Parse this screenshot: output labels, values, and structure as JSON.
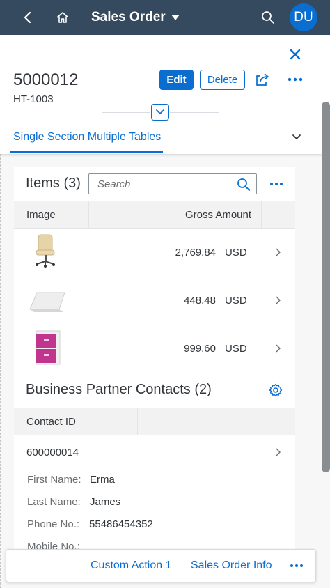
{
  "shell": {
    "title": "Sales Order",
    "avatar_initials": "DU",
    "icons": [
      "back-icon",
      "home-icon",
      "caret-down-icon",
      "search-icon"
    ],
    "background": "#354a5f"
  },
  "header": {
    "object_title": "5000012",
    "object_subtitle": "HT-1003",
    "edit_label": "Edit",
    "delete_label": "Delete",
    "tab_label": "Single Section Multiple Tables"
  },
  "items_table": {
    "title": "Items (3)",
    "search_placeholder": "Search",
    "columns": [
      "Image",
      "Gross Amount"
    ],
    "rows": [
      {
        "image": "office-chair-image",
        "amount": "2,769.84",
        "currency": "USD"
      },
      {
        "image": "table-tent-card-image",
        "amount": "448.48",
        "currency": "USD"
      },
      {
        "image": "pink-drawer-cabinet-image",
        "amount": "999.60",
        "currency": "USD"
      }
    ]
  },
  "contacts": {
    "title": "Business Partner Contacts (2)",
    "columns": [
      "Contact ID"
    ],
    "rows": [
      {
        "contact_id": "600000014",
        "first_name_label": "First Name:",
        "first_name": "Erma",
        "last_name_label": "Last Name:",
        "last_name": "James",
        "phone_label": "Phone No.:",
        "phone": "55486454352",
        "mobile_label": "Mobile No.:"
      }
    ]
  },
  "footer": {
    "action1_label": "Custom Action 1",
    "action2_label": "Sales Order Info"
  },
  "colors": {
    "accent": "#0a6ed1",
    "shell": "#354a5f",
    "text": "#32363a",
    "label": "#6a6d70",
    "content_bg": "#f7f7f7"
  }
}
